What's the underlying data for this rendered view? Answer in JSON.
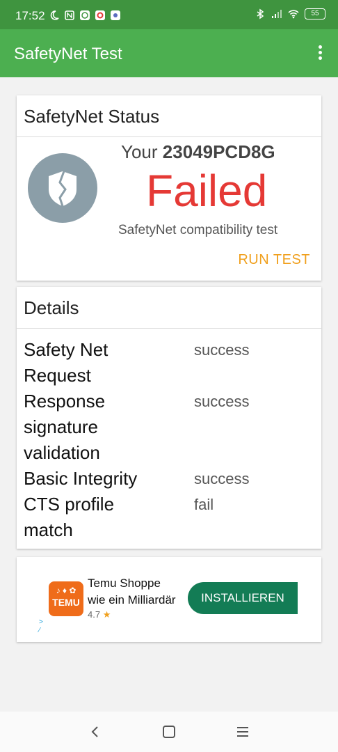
{
  "status_bar": {
    "time": "17:52",
    "battery": "55"
  },
  "app_bar": {
    "title": "SafetyNet Test"
  },
  "status_card": {
    "header": "SafetyNet Status",
    "device_prefix": "Your",
    "device_model": "23049PCD8G",
    "result": "Failed",
    "subtitle": "SafetyNet compatibility test",
    "run_button": "RUN TEST",
    "result_color": "#e53935"
  },
  "details_card": {
    "header": "Details",
    "rows": [
      {
        "key_lines": [
          "Safety Net",
          "Request"
        ],
        "value": "success"
      },
      {
        "key_lines": [
          "Response",
          "signature",
          "validation"
        ],
        "value": "success"
      },
      {
        "key_lines": [
          "Basic Integrity"
        ],
        "value": "success"
      },
      {
        "key_lines": [
          "CTS profile",
          "match"
        ],
        "value": "fail"
      }
    ]
  },
  "ad": {
    "app_name_line1": "Temu Shoppe",
    "app_name_line2": "wie ein Milliardär",
    "rating": "4.7",
    "install_button": "INSTALLIEREN",
    "logo_text": "TEMU"
  },
  "theme": {
    "primary": "#4caf50",
    "primary_dark": "#3f943f",
    "accent": "#f0a01e"
  }
}
